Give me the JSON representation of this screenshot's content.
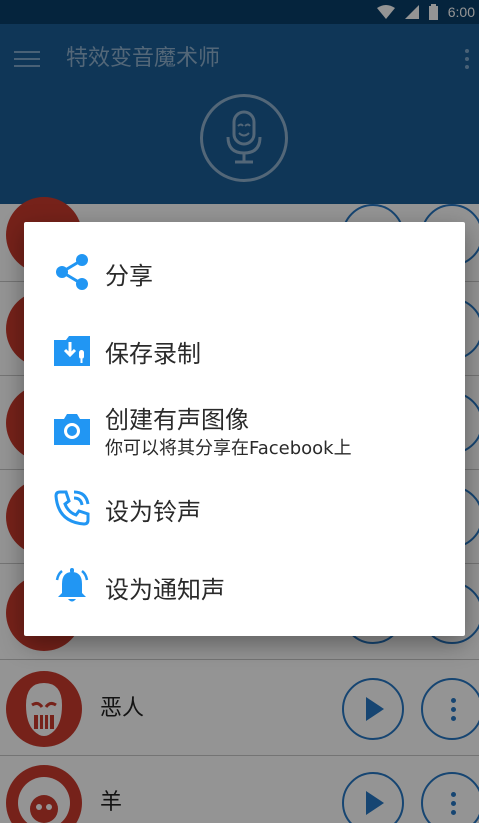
{
  "status_bar": {
    "time": "6:00"
  },
  "app_bar": {
    "title": "特效变音魔术师"
  },
  "list": {
    "items": [
      {
        "name": ""
      },
      {
        "name": ""
      },
      {
        "name": ""
      },
      {
        "name": ""
      },
      {
        "name": ""
      },
      {
        "name": "恶人"
      },
      {
        "name": "羊"
      }
    ]
  },
  "menu": {
    "items": [
      {
        "label": "分享",
        "icon": "share-icon"
      },
      {
        "label": "保存录制",
        "icon": "save-download-icon"
      },
      {
        "label": "创建有声图像",
        "sublabel": "你可以将其分享在Facebook上",
        "icon": "camera-icon"
      },
      {
        "label": "设为铃声",
        "icon": "phone-ring-icon"
      },
      {
        "label": "设为通知声",
        "icon": "bell-icon"
      }
    ]
  },
  "colors": {
    "accent": "#2196f3",
    "app_bar": "#1a5d96",
    "status_bar": "#0a3f69",
    "avatar": "#cc3b2e",
    "button_ring": "#2778c4"
  }
}
